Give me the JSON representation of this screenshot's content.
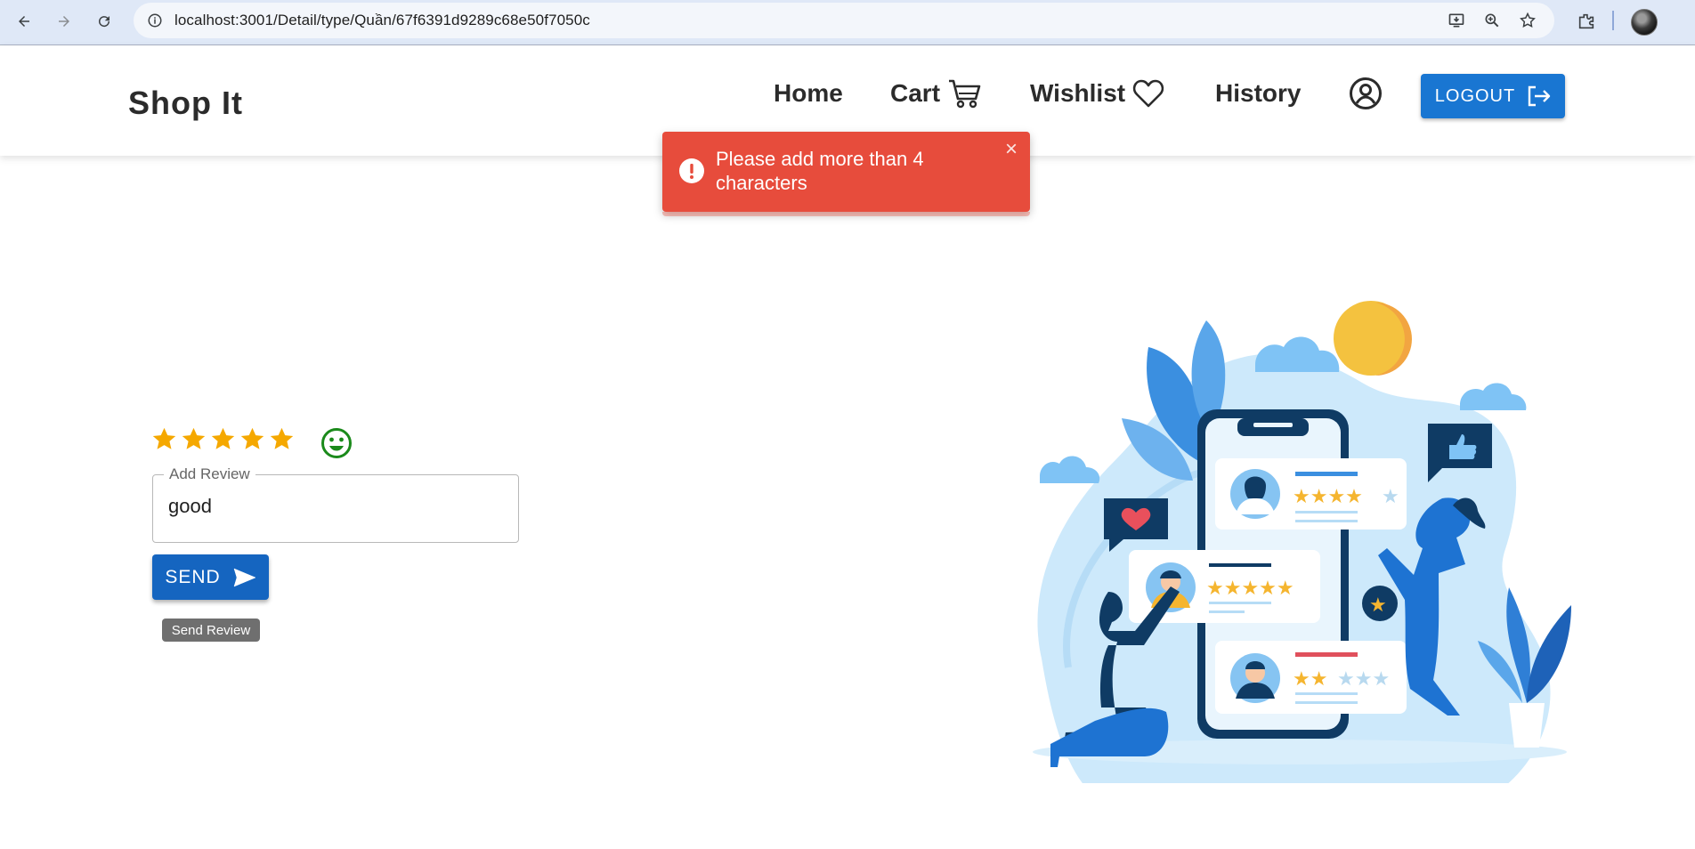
{
  "browser": {
    "url": "localhost:3001/Detail/type/Quần/67f6391d9289c68e50f7050c",
    "back_icon": "arrow-left-icon",
    "forward_icon": "arrow-right-icon",
    "reload_icon": "reload-icon"
  },
  "header": {
    "brand": "Shop It",
    "nav": [
      {
        "label": "Home"
      },
      {
        "label": "Cart",
        "icon": "cart-icon"
      },
      {
        "label": "Wishlist",
        "icon": "heart-icon"
      },
      {
        "label": "History"
      }
    ],
    "account_icon": "account-circle-icon",
    "logout_label": "LOGOUT"
  },
  "toast": {
    "message": "Please add more than 4 characters",
    "type": "error",
    "color": "#e74c3c"
  },
  "review": {
    "rating": 5,
    "rating_max": 5,
    "mood_icon": "smile-icon",
    "field_label": "Add Review",
    "field_value": "good",
    "send_label": "SEND",
    "tooltip": "Send Review"
  },
  "colors": {
    "primary": "#1976d2",
    "star": "#f5a800",
    "smile": "#1b8a1b"
  }
}
